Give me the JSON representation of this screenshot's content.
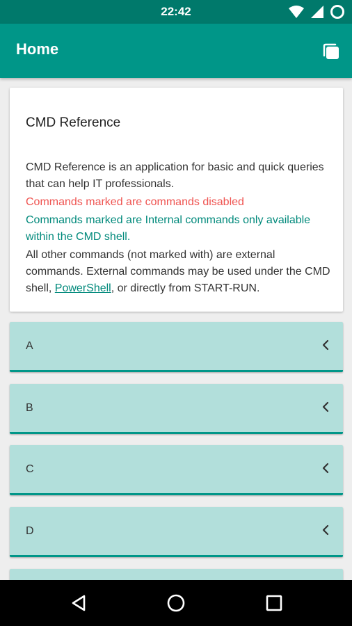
{
  "status_bar": {
    "time": "22:42",
    "icons": [
      "wifi-icon",
      "cell-signal-icon",
      "battery-icon"
    ]
  },
  "app_bar": {
    "title": "Home",
    "action_icon": "copy-icon"
  },
  "info_card": {
    "title": "CMD Reference",
    "description": "CMD Reference is an application for basic and quick queries that can help IT professionals.",
    "disabled_note": "Commands marked are commands disabled",
    "internal_note": "Commands marked are Internal commands only available within the CMD shell.",
    "external_note_before": "All other commands (not marked with) are external commands. External commands may be used under the CMD shell, ",
    "external_link": "PowerShell",
    "external_note_after": ", or directly from START-RUN."
  },
  "sections": [
    {
      "label": "A"
    },
    {
      "label": "B"
    },
    {
      "label": "C"
    },
    {
      "label": "D"
    }
  ],
  "nav_bar": {
    "icons": [
      "back-icon",
      "home-icon",
      "recents-icon"
    ]
  },
  "colors": {
    "primary": "#009688",
    "primary_dark": "#00796b",
    "row_background": "#b2dfdb",
    "disabled_text": "#ef5350",
    "internal_text": "#00897b"
  }
}
